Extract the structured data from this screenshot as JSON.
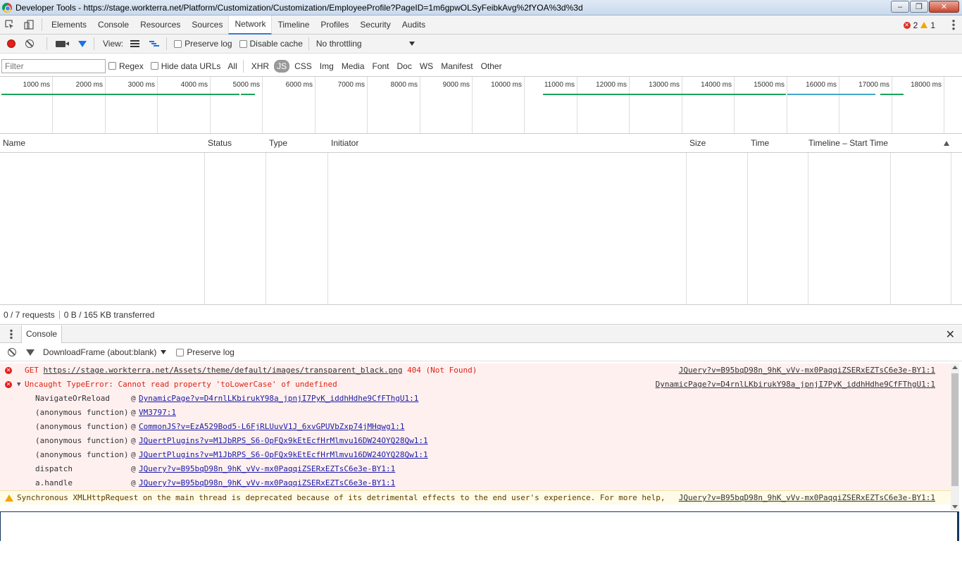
{
  "window": {
    "title": "Developer Tools - https://stage.workterra.net/Platform/Customization/Customization/EmployeeProfile?PageID=1m6gpwOLSyFeibkAvg%2fYOA%3d%3d",
    "minimize": "‒",
    "maximize": "❐",
    "close": "✕"
  },
  "tabs": [
    "Elements",
    "Console",
    "Resources",
    "Sources",
    "Network",
    "Timeline",
    "Profiles",
    "Security",
    "Audits"
  ],
  "active_tab": "Network",
  "counts": {
    "errors": "2",
    "warnings": "1"
  },
  "toolbar": {
    "view_label": "View:",
    "preserve_log": "Preserve log",
    "disable_cache": "Disable cache",
    "throttling": "No throttling"
  },
  "filter": {
    "placeholder": "Filter",
    "regex": "Regex",
    "hide_data_urls": "Hide data URLs",
    "types": [
      "All",
      "XHR",
      "JS",
      "CSS",
      "Img",
      "Media",
      "Font",
      "Doc",
      "WS",
      "Manifest",
      "Other"
    ],
    "selected_type": "JS"
  },
  "overview_ticks": [
    "1000 ms",
    "2000 ms",
    "3000 ms",
    "4000 ms",
    "5000 ms",
    "6000 ms",
    "7000 ms",
    "8000 ms",
    "9000 ms",
    "10000 ms",
    "11000 ms",
    "12000 ms",
    "13000 ms",
    "14000 ms",
    "15000 ms",
    "16000 ms",
    "17000 ms",
    "18000 ms"
  ],
  "columns": [
    "Name",
    "Status",
    "Type",
    "Initiator",
    "Size",
    "Time",
    "Timeline – Start Time"
  ],
  "summary": {
    "requests": "0 / 7 requests",
    "transferred": "0 B / 165 KB transferred"
  },
  "drawer": {
    "tab": "Console",
    "context": "DownloadFrame (about:blank)",
    "preserve_log": "Preserve log"
  },
  "messages": {
    "m1": {
      "method": "GET",
      "url": "https://stage.workterra.net/Assets/theme/default/images/transparent_black.png",
      "status": "404 (Not Found)",
      "source": "JQuery?v=B95bqD98n_9hK_vVv-mx0PaqqiZSERxEZTsC6e3e-BY1:1"
    },
    "m2": {
      "text": "Uncaught TypeError: Cannot read property 'toLowerCase' of undefined",
      "source": "DynamicPage?v=D4rnlLKbirukY98a_jpnjI7PyK_iddhHdhe9CfFThgU1:1",
      "frames": [
        {
          "fn": "NavigateOrReload",
          "link": "DynamicPage?v=D4rnlLKbirukY98a_jpnjI7PyK_iddhHdhe9CfFThgU1:1"
        },
        {
          "fn": "(anonymous function)",
          "link": "VM3797:1"
        },
        {
          "fn": "(anonymous function)",
          "link": "CommonJS?v=EzA529Bod5-L6FjRLUuvV1J_6xvGPUVbZxp74jMHqwg1:1"
        },
        {
          "fn": "(anonymous function)",
          "link": "JQuertPlugins?v=M1JbRPS_S6-OpFQx9kEtEcfHrMlmvu16DW24OYQ28Qw1:1"
        },
        {
          "fn": "(anonymous function)",
          "link": "JQuertPlugins?v=M1JbRPS_S6-OpFQx9kEtEcfHrMlmvu16DW24OYQ28Qw1:1"
        },
        {
          "fn": "dispatch",
          "link": "JQuery?v=B95bqD98n_9hK_vVv-mx0PaqqiZSERxEZTsC6e3e-BY1:1"
        },
        {
          "fn": "a.handle",
          "link": "JQuery?v=B95bqD98n_9hK_vVv-mx0PaqqiZSERxEZTsC6e3e-BY1:1"
        }
      ]
    },
    "m3": {
      "text": "Synchronous XMLHttpRequest on the main thread is deprecated because of its detrimental effects to the end user's experience. For more help,",
      "source": "JQuery?v=B95bqD98n_9hK_vVv-mx0PaqqiZSERxEZTsC6e3e-BY1:1"
    }
  },
  "colors": {
    "accent": "#3879d9",
    "error": "#d93025",
    "warning": "#f2a600",
    "waterfall": "#1aa35a"
  }
}
